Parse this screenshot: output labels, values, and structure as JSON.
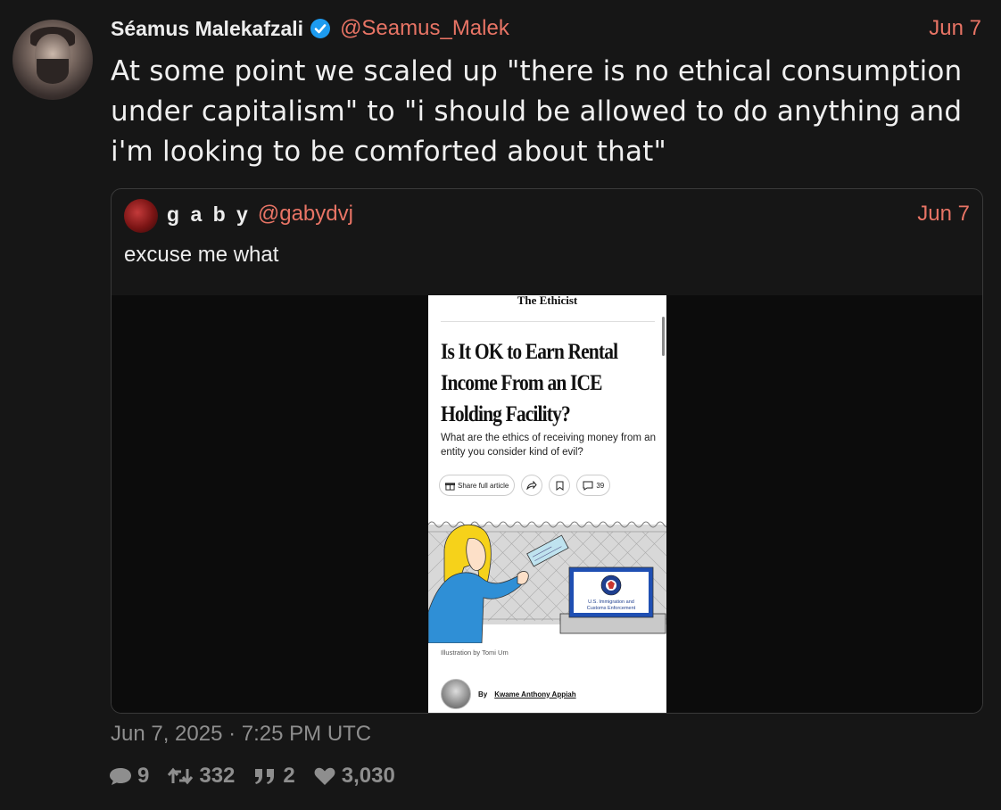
{
  "tweet": {
    "author_name": "Séamus Malekafzali",
    "handle": "@Seamus_Malek",
    "date": "Jun 7",
    "text": "At some point we scaled up \"there is no ethical consumption under capitalism\" to \"i should be allowed to do anything and i'm looking to be comforted about that\"",
    "timestamp": "Jun 7, 2025 · 7:25 PM UTC"
  },
  "quoted": {
    "author_name": "g a b y",
    "handle": "@gabydvj",
    "date": "Jun 7",
    "text": "excuse me what"
  },
  "article": {
    "kicker": "The Ethicist",
    "headline": "Is It OK to Earn Rental Income From an ICE Holding Facility?",
    "deck": "What are the ethics of receiving money from an entity you consider kind of evil?",
    "share_label": "Share full article",
    "comment_count": "39",
    "sign_text_1": "U.S. Immigration and",
    "sign_text_2": "Customs Enforcement",
    "credit": "Illustration by Tomi Um",
    "byline_prefix": "By",
    "byline_author": "Kwame Anthony Appiah"
  },
  "stats": {
    "replies": "9",
    "retweets": "332",
    "quotes": "2",
    "likes": "3,030"
  },
  "colors": {
    "accent": "#e87465",
    "background": "#161616",
    "verified": "#1d9bf0"
  }
}
